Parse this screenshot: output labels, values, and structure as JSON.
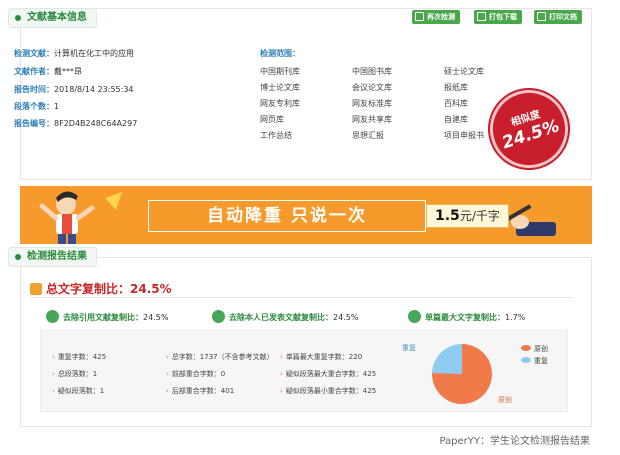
{
  "info": {
    "section_title": "文献基本信息",
    "buttons": [
      "再次检测",
      "打包下载",
      "打印文档"
    ],
    "fields": [
      {
        "label": "检测文献：",
        "value": "计算机在化工中的应用"
      },
      {
        "label": "文献作者：",
        "value": "戴***昂"
      },
      {
        "label": "报告时间：",
        "value": "2018/8/14 23:55:34"
      },
      {
        "label": "段落个数：",
        "value": "1"
      },
      {
        "label": "报告编号：",
        "value": "8F2D4B248C64A297"
      }
    ],
    "scope_label": "检测范围：",
    "scope_items": [
      "中国期刊库",
      "中国图书库",
      "硕士论文库",
      "博士论文库",
      "会议论文库",
      "报纸库",
      "网友专利库",
      "网友标准库",
      "百科库",
      "网页库",
      "网友共享库",
      "自建库",
      "工作总结",
      "思想汇报",
      "项目申报书"
    ],
    "stamp": {
      "label": "相似度",
      "value": "24.5%"
    }
  },
  "banner": {
    "slogan": "自动降重  只说一次",
    "price_number": "1.5",
    "price_unit": "元/千字"
  },
  "result": {
    "section_title": "检测报告结果",
    "total_label": "总文字复制比：",
    "total_value": "24.5%",
    "metrics": [
      {
        "label": "去除引用文献复制比：",
        "value": "24.5%"
      },
      {
        "label": "去除本人已发表文献复制比：",
        "value": "24.5%"
      },
      {
        "label": "单篇最大文字复制比：",
        "value": "1.7%"
      }
    ],
    "stats": [
      "重复字数：425",
      "总字数：1737（不含参考文献）",
      "单篇最大重复字数：220",
      "总段落数：1",
      "前部重合字数：0",
      "疑似段落最大重合字数：425",
      "疑似段落数：1",
      "后部重合字数：401",
      "疑似段落最小重合字数：425"
    ],
    "legend": [
      "原创",
      "重复"
    ],
    "pie_labels": [
      "重复",
      "原创"
    ]
  },
  "chart_data": {
    "type": "pie",
    "categories": [
      "原创",
      "重复"
    ],
    "values": [
      75.5,
      24.5
    ],
    "colors": [
      "#f07a4a",
      "#8dcbf0"
    ],
    "legend_position": "right"
  },
  "caption": "PaperYY：学生论文检测报告结果",
  "colors": {
    "accent_green": "#2c8a3d",
    "banner_orange": "#f59a2b",
    "alert_red": "#c62828",
    "stamp_red": "#c91e2c"
  }
}
